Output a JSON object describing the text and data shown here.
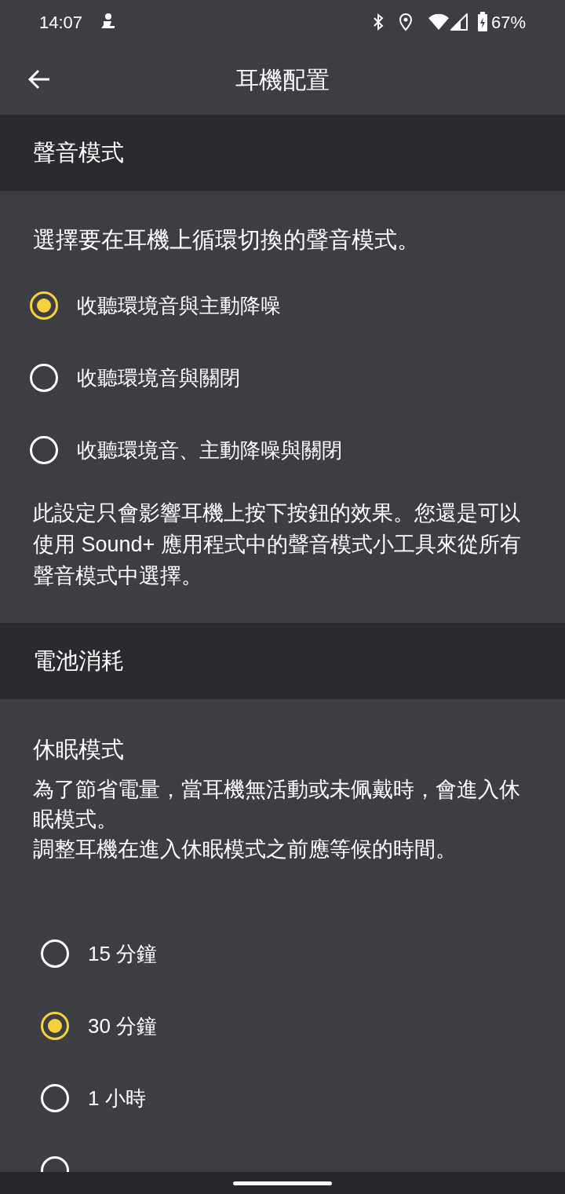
{
  "status_bar": {
    "time": "14:07",
    "battery": "67%"
  },
  "app_bar": {
    "title": "耳機配置"
  },
  "sections": [
    {
      "header": "聲音模式",
      "intro": "選擇要在耳機上循環切換的聲音模式。",
      "options": [
        {
          "label": "收聽環境音與主動降噪",
          "selected": true
        },
        {
          "label": "收聽環境音與關閉",
          "selected": false
        },
        {
          "label": "收聽環境音、主動降噪與關閉",
          "selected": false
        }
      ],
      "footnote": "此設定只會影響耳機上按下按鈕的效果。您還是可以使用 Sound+ 應用程式中的聲音模式小工具來從所有聲音模式中選擇。"
    },
    {
      "header": "電池消耗",
      "subtitle": "休眠模式",
      "descriptions": [
        "為了節省電量，當耳機無活動或未佩戴時，會進入休眠模式。",
        "調整耳機在進入休眠模式之前應等候的時間。"
      ],
      "options": [
        {
          "label": "15 分鐘",
          "selected": false
        },
        {
          "label": "30 分鐘",
          "selected": true
        },
        {
          "label": "1 小時",
          "selected": false
        },
        {
          "selected": false
        }
      ]
    }
  ]
}
